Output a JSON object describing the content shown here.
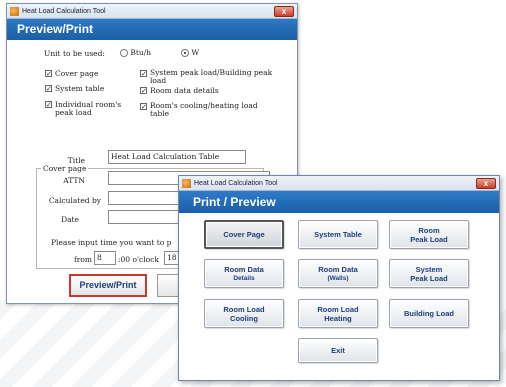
{
  "window_back": {
    "title": "Heat Load Calculation Tool",
    "close_glyph": "x",
    "banner": "Preview/Print",
    "unit_label": "Unit to be used:",
    "unit_options": [
      "Btu/h",
      "W"
    ],
    "unit_selected": "W",
    "check_mark": "✓",
    "checks": {
      "cover_page": "Cover page",
      "system_table": "System table",
      "individual_peak_1": "Individual room's",
      "individual_peak_2": "peak load",
      "system_peak_1": "System peak load/Building peak",
      "system_peak_2": "load",
      "room_data_details": "Room data details",
      "room_cooling_1": "Room's cooling/heating load",
      "room_cooling_2": "table"
    },
    "cover_group_label": "Cover page",
    "fields": {
      "title_label": "Title",
      "title_value": "Heat Load Calculation Table",
      "attn_label": "ATTN",
      "calc_label": "Calculated by",
      "date_label": "Date"
    },
    "time_prompt": "Please input time you want to p",
    "time": {
      "from_label": "from",
      "from_value": "8",
      "oclock_label": ":00 o'clock",
      "to_value": "18"
    },
    "preview_button": "Preview/Print"
  },
  "window_front": {
    "title": "Heat Load Calculation Tool",
    "close_glyph": "x",
    "banner": "Print / Preview",
    "buttons": [
      {
        "line1": "Cover Page",
        "line2": ""
      },
      {
        "line1": "System Table",
        "line2": ""
      },
      {
        "line1": "Room",
        "line2": "Peak Load"
      },
      {
        "line1": "Room Data",
        "line2": "Details"
      },
      {
        "line1": "Room Data",
        "line2": "(Walls)"
      },
      {
        "line1": "System",
        "line2": "Peak Load"
      },
      {
        "line1": "Room Load",
        "line2": "Cooling"
      },
      {
        "line1": "Room Load",
        "line2": "Heating"
      },
      {
        "line1": "Building Load",
        "line2": ""
      },
      {
        "line1": "Exit",
        "line2": ""
      }
    ]
  }
}
